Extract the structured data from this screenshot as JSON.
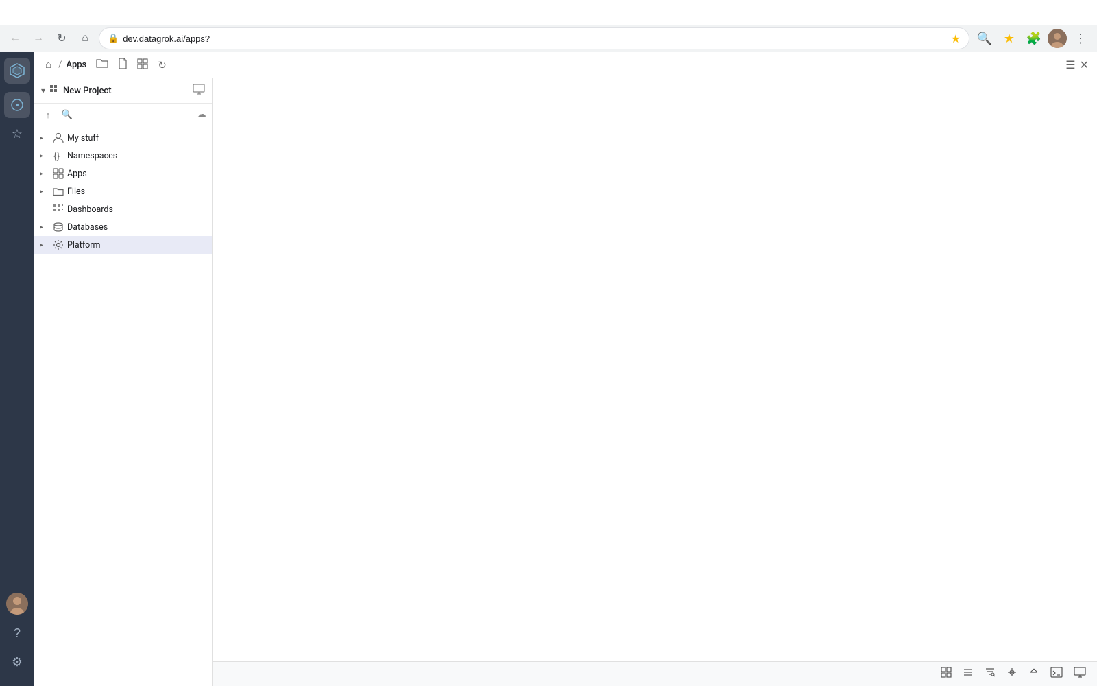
{
  "browser": {
    "url": "dev.datagrok.ai/apps?",
    "nav": {
      "back_disabled": true,
      "forward_disabled": true,
      "refresh_label": "↺",
      "home_label": "⌂"
    },
    "actions": {
      "search_label": "🔍",
      "bookmark_label": "★",
      "extensions_label": "🧩",
      "menu_label": "⋮"
    }
  },
  "breadcrumb": {
    "home_label": "⌂",
    "separator": "/",
    "current": "Apps",
    "actions": [
      {
        "label": "📁",
        "name": "open-folder-action"
      },
      {
        "label": "📄",
        "name": "new-file-action"
      },
      {
        "label": "⊞",
        "name": "grid-action"
      },
      {
        "label": "↻",
        "name": "refresh-action"
      }
    ],
    "right_actions": [
      {
        "label": "≡",
        "name": "menu-action"
      },
      {
        "label": "✕",
        "name": "close-action"
      }
    ]
  },
  "sidebar": {
    "icons": [
      {
        "name": "datagrok-logo",
        "label": "⬡",
        "active": true
      },
      {
        "name": "compass-icon",
        "label": "◎",
        "active": true
      },
      {
        "name": "star-icon",
        "label": "☆",
        "active": false
      }
    ],
    "bottom_icons": [
      {
        "name": "help-icon",
        "label": "?"
      },
      {
        "name": "settings-icon",
        "label": "⚙"
      }
    ]
  },
  "panel": {
    "header": {
      "title": "New Project",
      "chevron": "▾",
      "monitor_icon": "🖥"
    },
    "toolbar": {
      "up_label": "↑",
      "search_placeholder": "",
      "cloud_label": "☁"
    },
    "tree": [
      {
        "id": "my-stuff",
        "label": "My stuff",
        "icon": "person",
        "has_children": true,
        "expanded": false,
        "indent": 0
      },
      {
        "id": "namespaces",
        "label": "Namespaces",
        "icon": "curly",
        "has_children": true,
        "expanded": false,
        "indent": 0
      },
      {
        "id": "apps",
        "label": "Apps",
        "icon": "grid",
        "has_children": true,
        "expanded": false,
        "indent": 0
      },
      {
        "id": "files",
        "label": "Files",
        "icon": "folder",
        "has_children": true,
        "expanded": false,
        "indent": 0
      },
      {
        "id": "dashboards",
        "label": "Dashboards",
        "icon": "dotgrid",
        "has_children": false,
        "expanded": false,
        "indent": 1
      },
      {
        "id": "databases",
        "label": "Databases",
        "icon": "database",
        "has_children": true,
        "expanded": false,
        "indent": 0
      },
      {
        "id": "platform",
        "label": "Platform",
        "icon": "gear",
        "has_children": true,
        "expanded": false,
        "indent": 0,
        "selected": true
      }
    ]
  },
  "bottom_toolbar": {
    "buttons": [
      {
        "name": "grid-view-btn",
        "label": "▦"
      },
      {
        "name": "list-view-btn",
        "label": "≡"
      },
      {
        "name": "filter-btn",
        "label": "⚙"
      },
      {
        "name": "zoom-btn",
        "label": "🔍"
      },
      {
        "name": "collapse-btn",
        "label": "⇥"
      },
      {
        "name": "terminal-btn",
        "label": ">_"
      },
      {
        "name": "monitor-btn",
        "label": "🖥"
      }
    ]
  }
}
